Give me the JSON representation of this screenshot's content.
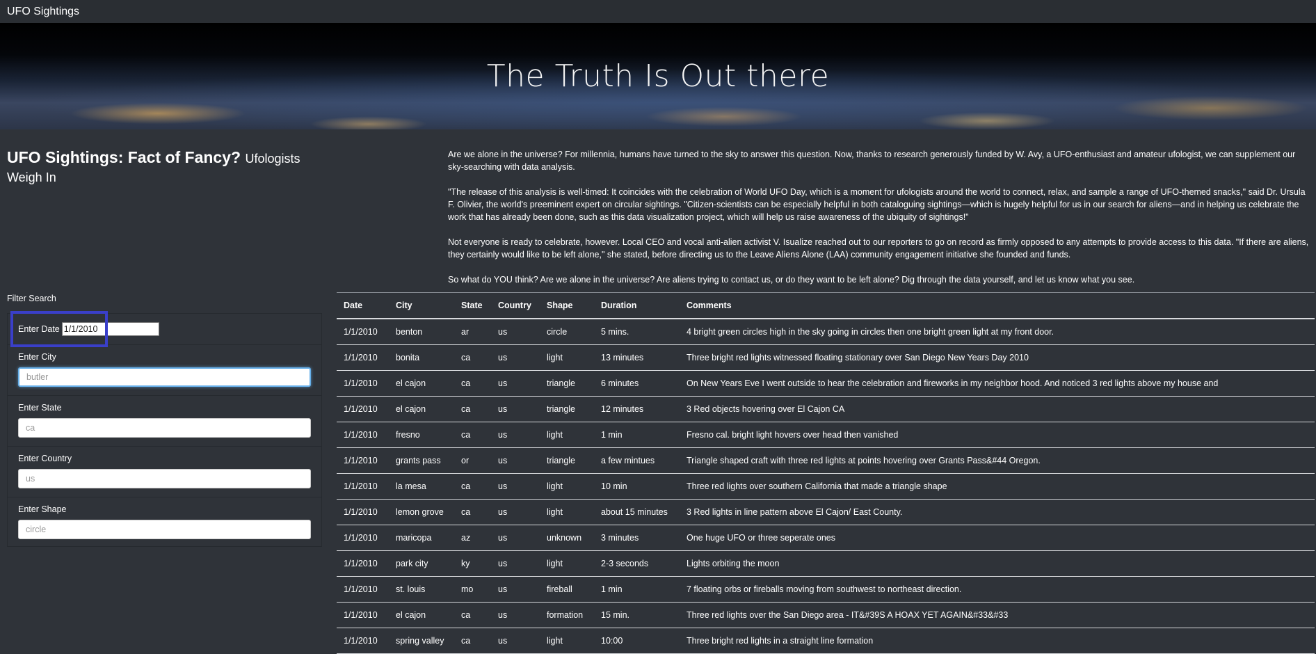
{
  "navbar": {
    "brand": "UFO Sightings"
  },
  "hero": {
    "title": "The Truth Is Out there"
  },
  "article": {
    "title": "UFO Sightings: Fact of Fancy?",
    "subtitle": "Ufologists Weigh In",
    "paragraphs": [
      "Are we alone in the universe? For millennia, humans have turned to the sky to answer this question. Now, thanks to research generously funded by W. Avy, a UFO-enthusiast and amateur ufologist, we can supplement our sky-searching with data analysis.",
      "\"The release of this analysis is well-timed: It coincides with the celebration of World UFO Day, which is a moment for ufologists around the world to connect, relax, and sample a range of UFO-themed snacks,\" said Dr. Ursula F. Olivier, the world's preeminent expert on circular sightings. \"Citizen-scientists can be especially helpful in both cataloguing sightings—which is hugely helpful for us in our search for aliens—and in helping us celebrate the work that has already been done, such as this data visualization project, which will help us raise awareness of the ubiquity of sightings!\"",
      "Not everyone is ready to celebrate, however. Local CEO and vocal anti-alien activist V. Isualize reached out to our reporters to go on record as firmly opposed to any attempts to provide access to this data. \"If there are aliens, they certainly would like to be left alone,\" she stated, before directing us to the Leave Aliens Alone (LAA) community engagement initiative she founded and funds.",
      "So what do YOU think? Are we alone in the universe? Are aliens trying to contact us, or do they want to be left alone? Dig through the data yourself, and let us know what you see."
    ]
  },
  "filters": {
    "heading": "Filter Search",
    "date": {
      "label": "Enter Date",
      "value": "1/1/2010"
    },
    "city": {
      "label": "Enter City",
      "placeholder": "butler"
    },
    "state": {
      "label": "Enter State",
      "placeholder": "ca"
    },
    "country": {
      "label": "Enter Country",
      "placeholder": "us"
    },
    "shape": {
      "label": "Enter Shape",
      "placeholder": "circle"
    }
  },
  "table": {
    "headers": [
      "Date",
      "City",
      "State",
      "Country",
      "Shape",
      "Duration",
      "Comments"
    ],
    "rows": [
      [
        "1/1/2010",
        "benton",
        "ar",
        "us",
        "circle",
        "5 mins.",
        "4 bright green circles high in the sky going in circles then one bright green light at my front door."
      ],
      [
        "1/1/2010",
        "bonita",
        "ca",
        "us",
        "light",
        "13 minutes",
        "Three bright red lights witnessed floating stationary over San Diego New Years Day 2010"
      ],
      [
        "1/1/2010",
        "el cajon",
        "ca",
        "us",
        "triangle",
        "6 minutes",
        "On New Years Eve I went outside to hear the celebration and fireworks in my neighbor hood. And noticed 3 red lights above my house and"
      ],
      [
        "1/1/2010",
        "el cajon",
        "ca",
        "us",
        "triangle",
        "12 minutes",
        "3 Red objects hovering over El Cajon CA"
      ],
      [
        "1/1/2010",
        "fresno",
        "ca",
        "us",
        "light",
        "1 min",
        "Fresno cal. bright light hovers over head then vanished"
      ],
      [
        "1/1/2010",
        "grants pass",
        "or",
        "us",
        "triangle",
        "a few mintues",
        "Triangle shaped craft with three red lights at points hovering over Grants Pass&#44 Oregon."
      ],
      [
        "1/1/2010",
        "la mesa",
        "ca",
        "us",
        "light",
        "10 min",
        "Three red lights over southern California that made a triangle shape"
      ],
      [
        "1/1/2010",
        "lemon grove",
        "ca",
        "us",
        "light",
        "about 15 minutes",
        "3 Red lights in line pattern above El Cajon/ East County."
      ],
      [
        "1/1/2010",
        "maricopa",
        "az",
        "us",
        "unknown",
        "3 minutes",
        "One huge UFO or three seperate ones"
      ],
      [
        "1/1/2010",
        "park city",
        "ky",
        "us",
        "light",
        "2-3 seconds",
        "Lights orbiting the moon"
      ],
      [
        "1/1/2010",
        "st. louis",
        "mo",
        "us",
        "fireball",
        "1 min",
        "7 floating orbs or fireballs moving from southwest to northeast direction."
      ],
      [
        "1/1/2010",
        "el cajon",
        "ca",
        "us",
        "formation",
        "15 min.",
        "Three red lights over the San Diego area - IT&#39S A HOAX YET AGAIN&#33&#33"
      ],
      [
        "1/1/2010",
        "spring valley",
        "ca",
        "us",
        "light",
        "10:00",
        "Three bright red lights in a straight line formation"
      ]
    ]
  }
}
